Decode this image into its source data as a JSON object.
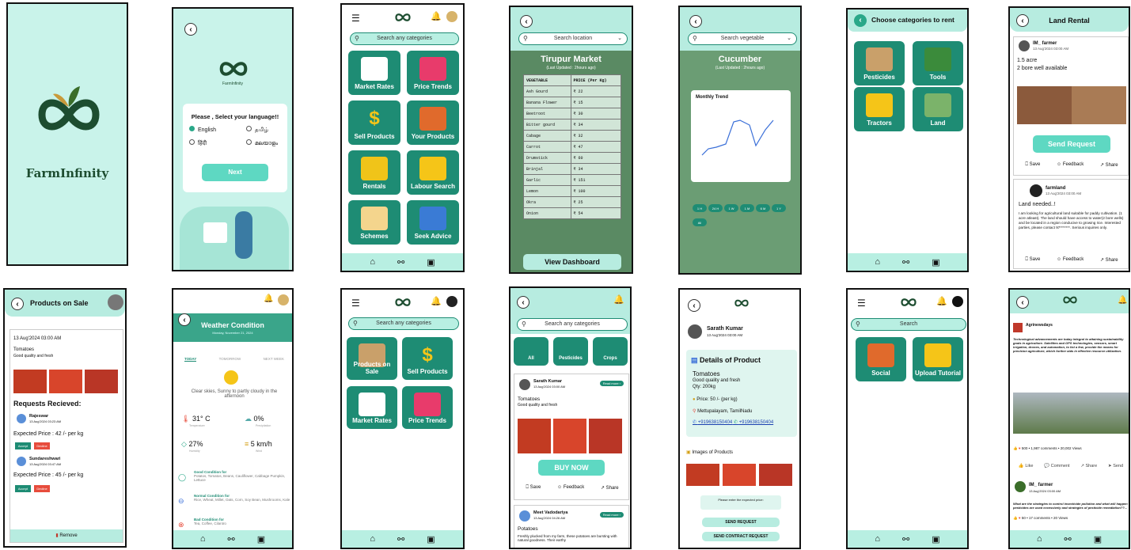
{
  "splash": {
    "brand": "FarmInfinity"
  },
  "lang": {
    "title": "Please , Select your language!!",
    "opts": [
      "English",
      "தமிழ்",
      "हिंदी",
      "മലയാളം"
    ],
    "next": "Next",
    "brand": "FarmInfinity"
  },
  "home": {
    "search": "Search any categories",
    "tiles": [
      "Market Rates",
      "Price Trends",
      "Sell Products",
      "Your Products",
      "Rentals",
      "Labour Search",
      "Schemes",
      "Seek Advice"
    ]
  },
  "market": {
    "search": "Search location",
    "title": "Tirupur Market",
    "updated": "(Last Updated : 2hours ago)",
    "col1": "VEGETABLE",
    "col2": "PRICE (Per Kg)",
    "rows": [
      [
        "Ash Gourd",
        "₹ 22"
      ],
      [
        "Banana Flower",
        "₹ 15"
      ],
      [
        "Beetroot",
        "₹ 30"
      ],
      [
        "Bitter gourd",
        "₹ 34"
      ],
      [
        "Cabage",
        "₹ 32"
      ],
      [
        "Carrot",
        "₹ 47"
      ],
      [
        "Drumstick",
        "₹ 60"
      ],
      [
        "Brinjal",
        "₹ 34"
      ],
      [
        "Garlic",
        "₹ 151"
      ],
      [
        "Lemon",
        "₹ 100"
      ],
      [
        "Okra",
        "₹ 25"
      ],
      [
        "Onion",
        "₹ 54"
      ]
    ],
    "dash": "View Dashboard"
  },
  "veg": {
    "search": "Search vegetable",
    "title": "Cucumber",
    "updated": "(Last Updated : 2hours ago)",
    "chart_title": "Monthly Trend",
    "ranges": [
      "1 H",
      "24 H",
      "1 W",
      "1 M",
      "6 M",
      "1 Y",
      "All"
    ]
  },
  "rentcat": {
    "title": "Choose categories to rent",
    "items": [
      "Pesticides",
      "Tools",
      "Tractors",
      "Land"
    ]
  },
  "land": {
    "title": "Land Rental",
    "user1": "IM_ farmer",
    "date1": "13 Aug'2024 03:00 AM",
    "l1": "1.5 acre",
    "l2": "2 bore well available",
    "send": "Send Request",
    "save": "Save",
    "feedback": "Feedback",
    "share": "Share",
    "user2": "farmland",
    "date2": "13 Aug'2024 03:00 AM",
    "need": "Land needed..!",
    "body": "I am looking for agricultural land suitable for paddy cultivation. (1 acre atleast). The land should have access to water(2 bore wells) and be located in a region conducive to growing rice. Interested parties, please contact 97*******. Serious inquiries only."
  },
  "sale": {
    "title": "Products on Sale",
    "date": "13 Aug'2024 03:00 AM",
    "prod": "Tomatoes",
    "desc": "Good quality and fresh",
    "req": "Requests Recieved:",
    "r1": "Rajeswar",
    "r1d": "13 Aug'2024 03:23 AM",
    "p1": "Expected Price : 42 /- per kg",
    "r2": "Sundareshwari",
    "r2d": "13 Aug'2024 03:47 AM",
    "p2": "Expected Price : 45 /- per kg",
    "accept": "Accept",
    "decline": "Decline",
    "remove": "Remove"
  },
  "weather": {
    "title": "Weather Condition",
    "date": "Monday, November 21, 2024",
    "tabs": [
      "TODAY",
      "TOMORROW",
      "NEXT WEEK"
    ],
    "sky": "Clear skies, Sunny to partly cloudy in the afternoon",
    "temp": "31° C",
    "tempL": "Temperature",
    "prec": "0%",
    "precL": "Precipitation",
    "hum": "27%",
    "humL": "Humidity",
    "wind": "5 km/h",
    "windL": "Wind",
    "g": "Good Condition for",
    "gt": "Potatos, Tomatos, Beans, Cauliflower, Cabbage Pumpkin, Lettuce",
    "n": "Normal Condition for",
    "nt": "Rice, Wheat, Millet, Oats, Corn, Soy Bean, Mushrooms, Kale",
    "b": "Bad Condition for",
    "bt": "Tea, Coffee, Cilantro"
  },
  "home2": {
    "search": "Search any categories",
    "tiles": [
      "Products on Sale",
      "Sell Products",
      "Market Rates",
      "Price Trends"
    ]
  },
  "buy": {
    "search": "Search any categories",
    "cats": [
      "All",
      "Pesticides",
      "Crops"
    ],
    "user": "Sarath Kumar",
    "date": "13 Aug'2024 03:00 AM",
    "readmore": "Read more",
    "prod": "Tomatoes",
    "desc": "Good quality and fresh",
    "user2": "Sarath Kumar",
    "date2": "13 Aug'2024 03:00 AM",
    "buy": "BUY NOW",
    "save": "Save",
    "feedback": "Feedback",
    "share": "Share",
    "user3": "Meet Vadodariya",
    "date3": "13 Aug'2024 04:26 AM",
    "prod3": "Potatoes",
    "desc3": "Freshly plucked from my farm, these potatoes are bursting with natural goodness. Their earthy"
  },
  "detail": {
    "user": "Sarath Kumar",
    "date": "13 Aug'2024 03:00 AM",
    "head": "Details of Product",
    "prod": "Tomatoes",
    "desc": "Good quality and fresh",
    "qty": "Qty: 200kg",
    "price": "Price: 50 /- (per kg)",
    "loc": "Mettupalayam, TamilNadu",
    "ph1": "+919638150404",
    "ph2": "+919638150404",
    "imgs": "Images of Products",
    "enter": "Please enter the expected price:",
    "send": "SEND REQUEST",
    "contract": "SEND CONTRACT REQUEST"
  },
  "social": {
    "search": "Search",
    "tiles": [
      "Social",
      "Upload Tutorial"
    ]
  },
  "feed": {
    "user": "Agrinewsdays",
    "post": "Technological advancements are today integral to attaining sustainability goals in agriculture. Satellites and GPS technologies, sensors, smart irrigation, drones, and automation, to list a few, provide the means for precision agriculture, which further aids in effective resource utilization.",
    "stats": "500 • 1,987 comments • 20,002 Views",
    "like": "Like",
    "comment": "Comment",
    "share": "Share",
    "send": "Send",
    "user2": "IM_ farmer",
    "date2": "13 Aug'2024 03:00 AM",
    "q": "What are the strategies to control insecticide pollution and what will happen pesticides are used excessively and strategies of pesticide remediation??...",
    "stats2": "50 • 17 comments • 20 Views"
  }
}
